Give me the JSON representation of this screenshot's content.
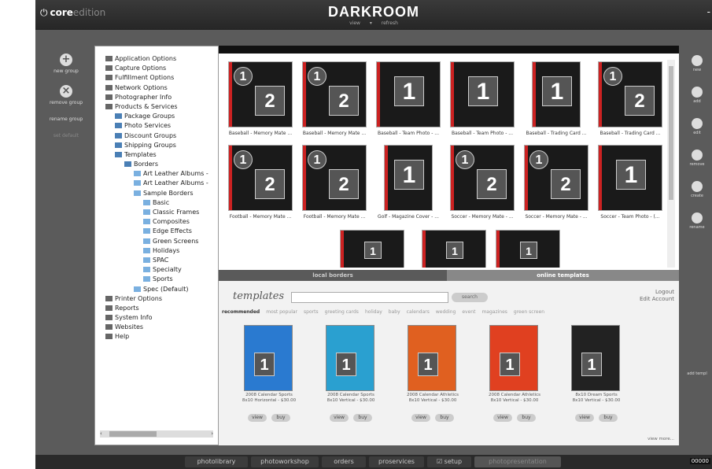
{
  "app": {
    "edition_bold": "core",
    "edition_thin": "edition",
    "brand": "DARKROOM",
    "view_menu": "view ▾",
    "refresh": "refresh",
    "minimize": "-"
  },
  "left_actions": [
    "new group",
    "remove group",
    "rename group",
    "set default"
  ],
  "tree": [
    {
      "label": "Application Options",
      "depth": 0,
      "icon": "app-options-icon"
    },
    {
      "label": "Capture Options",
      "depth": 0,
      "icon": "camera-icon"
    },
    {
      "label": "Fulfillment Options",
      "depth": 0,
      "icon": "fulfillment-icon"
    },
    {
      "label": "Network Options",
      "depth": 0,
      "icon": "network-icon"
    },
    {
      "label": "Photographer Info",
      "depth": 0,
      "icon": "photographer-icon"
    },
    {
      "label": "Products & Services",
      "depth": 0,
      "icon": "products-icon"
    },
    {
      "label": "Package Groups",
      "depth": 1,
      "icon": "package-icon"
    },
    {
      "label": "Photo Services",
      "depth": 1,
      "icon": "photo-services-icon"
    },
    {
      "label": "Discount Groups",
      "depth": 1,
      "icon": "discount-icon"
    },
    {
      "label": "Shipping Groups",
      "depth": 1,
      "icon": "shipping-icon"
    },
    {
      "label": "Templates",
      "depth": 1,
      "icon": "folder-icon"
    },
    {
      "label": "Borders",
      "depth": 2,
      "icon": "folder-icon"
    },
    {
      "label": "Art Leather Albums -",
      "depth": 3,
      "icon": "folder-icon"
    },
    {
      "label": "Art Leather Albums -",
      "depth": 3,
      "icon": "folder-icon"
    },
    {
      "label": "Sample Borders",
      "depth": 3,
      "icon": "folder-icon"
    },
    {
      "label": "Basic",
      "depth": 4,
      "icon": "folder-icon"
    },
    {
      "label": "Classic Frames",
      "depth": 4,
      "icon": "folder-icon"
    },
    {
      "label": "Composites",
      "depth": 4,
      "icon": "folder-icon"
    },
    {
      "label": "Edge Effects",
      "depth": 4,
      "icon": "folder-icon"
    },
    {
      "label": "Green Screens",
      "depth": 4,
      "icon": "folder-icon"
    },
    {
      "label": "Holidays",
      "depth": 4,
      "icon": "folder-icon"
    },
    {
      "label": "SPAC",
      "depth": 4,
      "icon": "folder-icon"
    },
    {
      "label": "Specialty",
      "depth": 4,
      "icon": "folder-icon"
    },
    {
      "label": "Sports",
      "depth": 4,
      "icon": "folder-icon"
    },
    {
      "label": "Spec (Default)",
      "depth": 3,
      "icon": "folder-icon"
    },
    {
      "label": "Printer Options",
      "depth": 0,
      "icon": "printer-icon"
    },
    {
      "label": "Reports",
      "depth": 0,
      "icon": "reports-icon"
    },
    {
      "label": "System Info",
      "depth": 0,
      "icon": "system-info-icon"
    },
    {
      "label": "Websites",
      "depth": 0,
      "icon": "globe-icon"
    },
    {
      "label": "Help",
      "depth": 0,
      "icon": "help-icon"
    }
  ],
  "templates": [
    {
      "caption": "Baseball - Memory Mate ...",
      "nums": [
        "1",
        "2"
      ]
    },
    {
      "caption": "Baseball - Memory Mate ...",
      "nums": [
        "1",
        "2"
      ]
    },
    {
      "caption": "Baseball - Team Photo - ...",
      "nums": [
        "1"
      ]
    },
    {
      "caption": "Baseball - Team Photo - ...",
      "nums": [
        "1"
      ]
    },
    {
      "caption": "Baseball - Trading Card ...",
      "nums": [
        "1"
      ]
    },
    {
      "caption": "Baseball - Trading Card ...",
      "nums": [
        "1",
        "2"
      ]
    },
    {
      "caption": "Football - Memory Mate ...",
      "nums": [
        "1",
        "2"
      ]
    },
    {
      "caption": "Football - Memory Mate ...",
      "nums": [
        "1",
        "2"
      ]
    },
    {
      "caption": "Golf - Magazine Cover - ...",
      "nums": [
        "1"
      ]
    },
    {
      "caption": "Soccer - Memory Mate - ...",
      "nums": [
        "1",
        "2"
      ]
    },
    {
      "caption": "Soccer - Memory Mate - ...",
      "nums": [
        "1",
        "2"
      ]
    },
    {
      "caption": "Soccer - Team Photo - (...",
      "nums": [
        "1"
      ]
    },
    {
      "caption": "",
      "nums": [
        "1"
      ]
    },
    {
      "caption": "",
      "nums": [
        "1"
      ]
    },
    {
      "caption": "",
      "nums": [
        "1"
      ]
    }
  ],
  "tabs": {
    "local": "local borders",
    "online": "online templates"
  },
  "online": {
    "logo": "templates",
    "search_label": "search",
    "logout": "Logout",
    "edit_account": "Edit Account",
    "view_more": "view more...",
    "categories": [
      "recommended",
      "most popular",
      "sports",
      "greeting cards",
      "holiday",
      "baby",
      "calendars",
      "wedding",
      "event",
      "magazines",
      "green screen"
    ],
    "products": [
      {
        "name": "2008 Calendar Sports",
        "price": "8x10 Horizontal - $30.00",
        "color": "#2a7ad0"
      },
      {
        "name": "2008 Calendar Sports",
        "price": "8x10 Vertical - $30.00",
        "color": "#2aa0d0"
      },
      {
        "name": "2008 Calendar Athletics",
        "price": "8x10 Vertical - $30.00",
        "color": "#e06020"
      },
      {
        "name": "2008 Calendar Athletics",
        "price": "8x10 Vertical - $30.00",
        "color": "#e04020"
      },
      {
        "name": "8x10 Dream Sports",
        "price": "8x10 Vertical - $30.00",
        "color": "#222"
      }
    ],
    "view": "view",
    "buy": "buy"
  },
  "right_actions": [
    "new",
    "add",
    "edit",
    "remove",
    "create",
    "rename"
  ],
  "right_bottom": "add templ",
  "bottom_nav": [
    "photolibrary",
    "photoworkshop",
    "orders",
    "proservices",
    "setup",
    "photopresentation"
  ],
  "counter": "00000"
}
